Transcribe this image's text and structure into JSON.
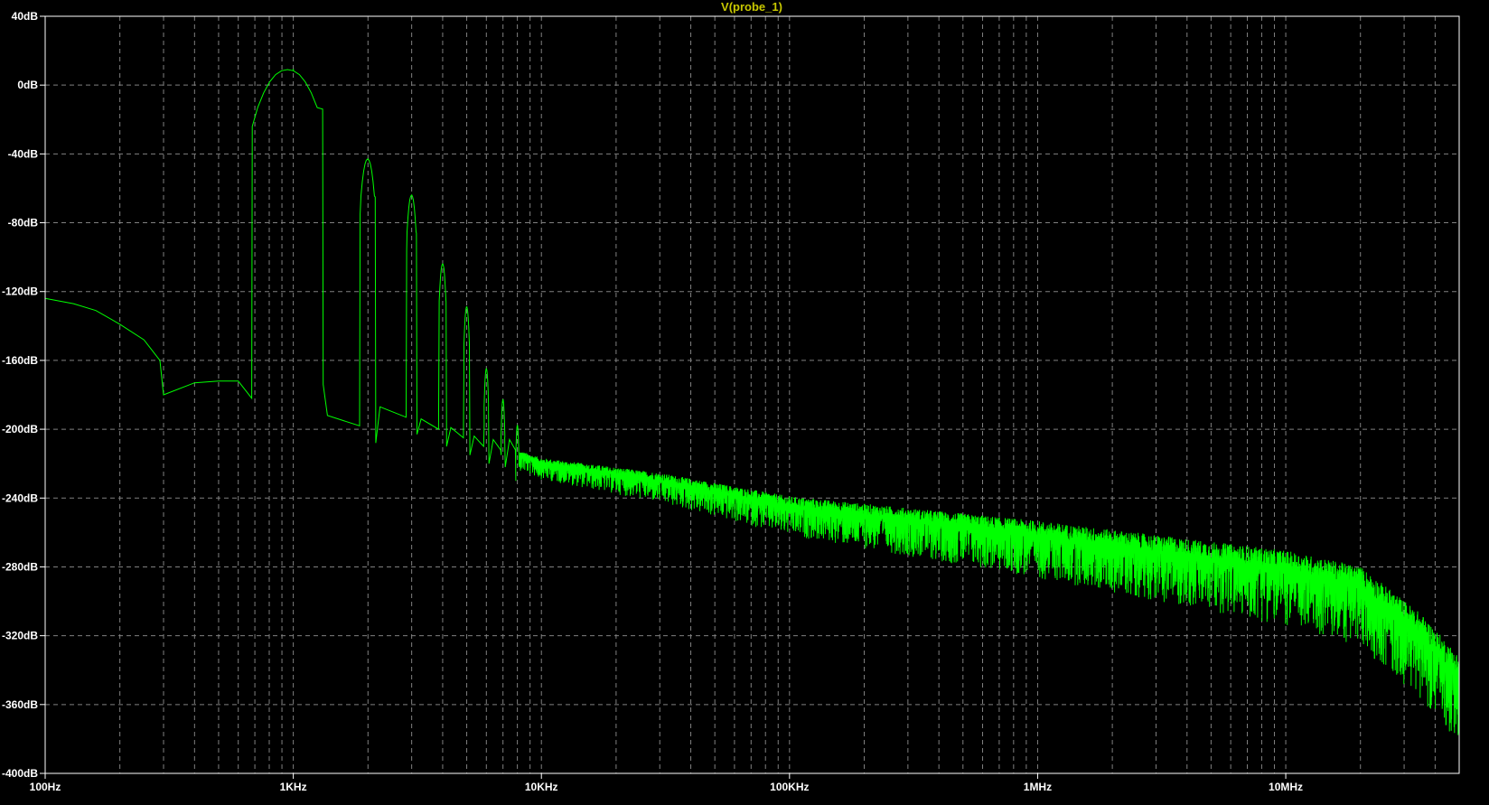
{
  "chart_data": {
    "type": "line",
    "title": "V(probe_1)",
    "xlabel": "",
    "ylabel": "",
    "x_scale": "log",
    "xlim": [
      100,
      50000000
    ],
    "ylim": [
      -400,
      40
    ],
    "grid": true,
    "legend": "none",
    "x_ticks": [
      {
        "value": 100,
        "label": "100Hz"
      },
      {
        "value": 1000,
        "label": "1KHz"
      },
      {
        "value": 10000,
        "label": "10KHz"
      },
      {
        "value": 100000,
        "label": "100KHz"
      },
      {
        "value": 1000000,
        "label": "1MHz"
      },
      {
        "value": 10000000,
        "label": "10MHz"
      }
    ],
    "y_ticks": [
      {
        "value": 40,
        "label": "40dB"
      },
      {
        "value": 0,
        "label": "0dB"
      },
      {
        "value": -40,
        "label": "-40dB"
      },
      {
        "value": -80,
        "label": "-80dB"
      },
      {
        "value": -120,
        "label": "-120dB"
      },
      {
        "value": -160,
        "label": "-160dB"
      },
      {
        "value": -200,
        "label": "-200dB"
      },
      {
        "value": -240,
        "label": "-240dB"
      },
      {
        "value": -280,
        "label": "-280dB"
      },
      {
        "value": -320,
        "label": "-320dB"
      },
      {
        "value": -360,
        "label": "-360dB"
      },
      {
        "value": -400,
        "label": "-400dB"
      }
    ],
    "series": [
      {
        "color": "#00ff00",
        "peaks": [
          {
            "x": 1000,
            "y": 9
          },
          {
            "x": 2000,
            "y": -43
          },
          {
            "x": 3000,
            "y": -64
          },
          {
            "x": 4000,
            "y": -104
          },
          {
            "x": 5000,
            "y": -129
          },
          {
            "x": 6000,
            "y": -165
          },
          {
            "x": 7000,
            "y": -183
          },
          {
            "x": 8000,
            "y": -198
          }
        ],
        "low_band": [
          {
            "x": 100,
            "y": -124
          },
          {
            "x": 130,
            "y": -127
          },
          {
            "x": 160,
            "y": -131
          },
          {
            "x": 200,
            "y": -139
          },
          {
            "x": 250,
            "y": -148
          },
          {
            "x": 290,
            "y": -160
          },
          {
            "x": 300,
            "y": -180
          },
          {
            "x": 400,
            "y": -173
          },
          {
            "x": 500,
            "y": -172
          },
          {
            "x": 600,
            "y": -172
          },
          {
            "x": 680,
            "y": -182
          }
        ],
        "noise_floor": [
          {
            "x": 8000,
            "y": -215
          },
          {
            "x": 10000,
            "y": -220
          },
          {
            "x": 30000,
            "y": -230
          },
          {
            "x": 100000,
            "y": -245
          },
          {
            "x": 1000000,
            "y": -262
          },
          {
            "x": 10000000,
            "y": -282
          },
          {
            "x": 20000000,
            "y": -292
          },
          {
            "x": 35000000,
            "y": -320
          },
          {
            "x": 50000000,
            "y": -345
          }
        ]
      }
    ]
  },
  "colors": {
    "background": "#000000",
    "axis": "#ffffff",
    "grid": "#808080",
    "trace": "#00ff00",
    "title": "#c8c800",
    "tick_label": "#ffffff"
  }
}
